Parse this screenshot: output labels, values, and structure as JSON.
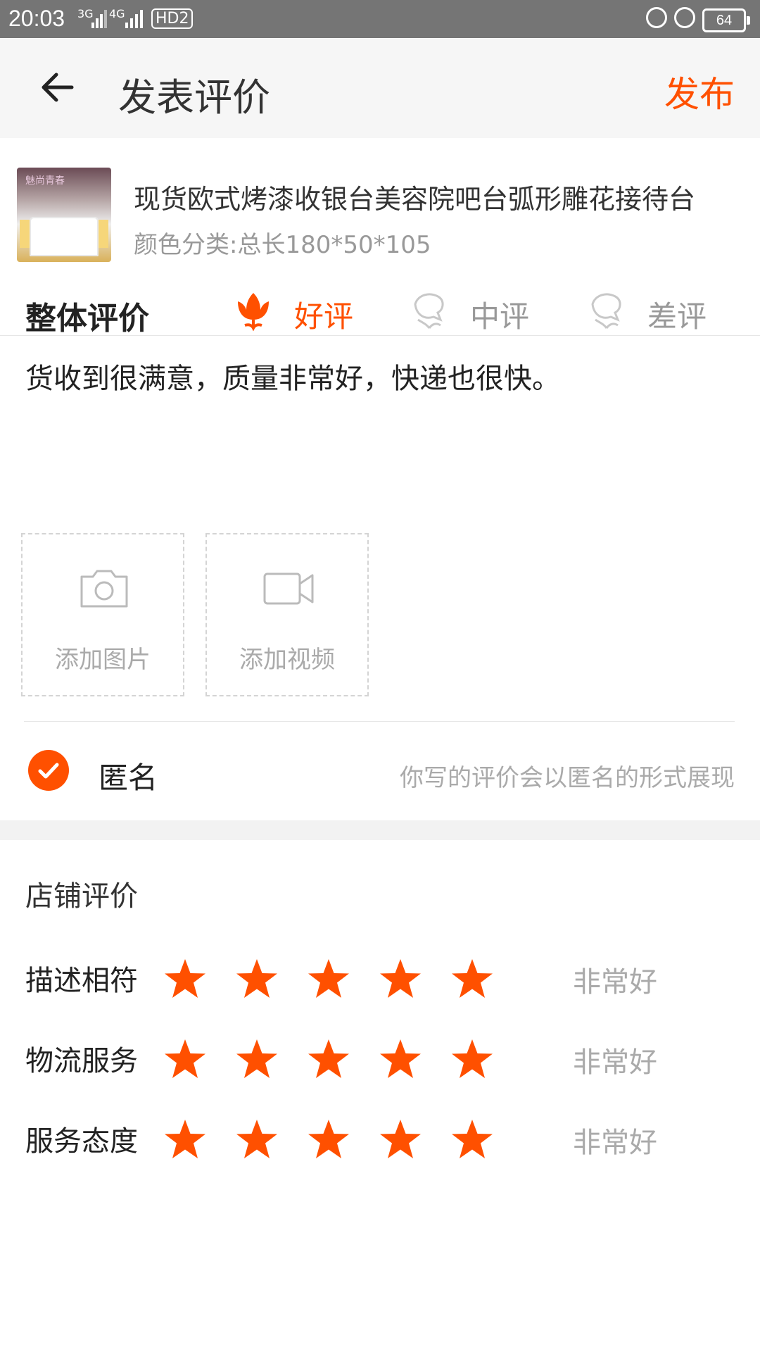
{
  "status_bar": {
    "time": "20:03",
    "network_1": "3G",
    "network_2": "4G",
    "hd": "HD2",
    "battery": "64"
  },
  "header": {
    "title": "发表评价",
    "publish_label": "发布"
  },
  "product": {
    "title": "现货欧式烤漆收银台美容院吧台弧形雕花接待台",
    "sku": "颜色分类:总长180*50*105",
    "thumb_sign": "魅尚青春"
  },
  "overall_rating": {
    "label": "整体评价",
    "options": [
      {
        "label": "好评",
        "selected": true
      },
      {
        "label": "中评",
        "selected": false
      },
      {
        "label": "差评",
        "selected": false
      }
    ]
  },
  "review_text": "货收到很满意，质量非常好，快递也很快。",
  "upload": {
    "add_photo": "添加图片",
    "add_video": "添加视频"
  },
  "anonymous": {
    "label": "匿名",
    "hint": "你写的评价会以匿名的形式展现",
    "checked": true
  },
  "shop_rating": {
    "title": "店铺评价",
    "rows": [
      {
        "label": "描述相符",
        "stars": 5,
        "value": "非常好"
      },
      {
        "label": "物流服务",
        "stars": 5,
        "value": "非常好"
      },
      {
        "label": "服务态度",
        "stars": 5,
        "value": "非常好"
      }
    ]
  },
  "colors": {
    "accent": "#ff5000",
    "muted": "#aaaaaa"
  }
}
